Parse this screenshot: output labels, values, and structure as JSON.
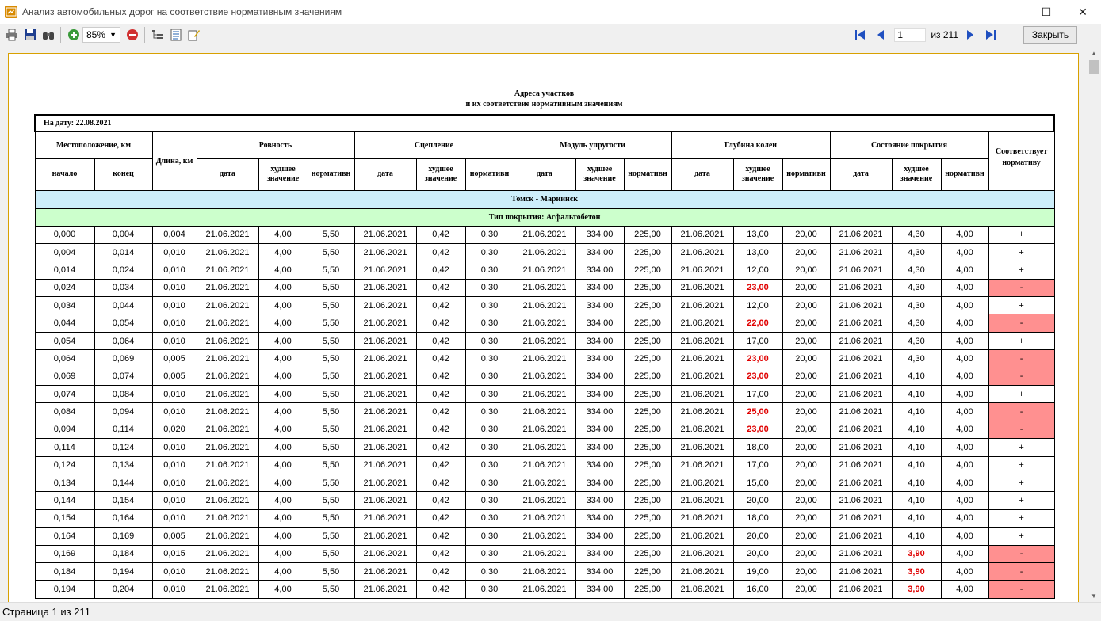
{
  "window": {
    "title": "Анализ автомобильных дорог на соответствие нормативным значениям",
    "minimize_glyph": "—",
    "maximize_glyph": "☐",
    "close_glyph": "✕"
  },
  "toolbar": {
    "zoom_value": "85%",
    "icons": [
      "print-icon",
      "save-icon",
      "find-icon",
      "zoom-in-icon",
      "zoom-out-icon",
      "outline-icon",
      "page-setup-icon",
      "edit-icon"
    ]
  },
  "navigation": {
    "current_page": "1",
    "page_total_label": "из 211",
    "close_label": "Закрыть"
  },
  "report": {
    "title_line1": "Адреса участков",
    "title_line2": "и их соответствие нормативным значениям",
    "date_label": "На дату: 22.08.2021",
    "col_location": "Местоположение, км",
    "col_length": "Длина, км",
    "col_start": "начало",
    "col_end": "конец",
    "groups": [
      "Ровность",
      "Сцепление",
      "Модуль упругости",
      "Глубина колеи",
      "Состояние покрытия"
    ],
    "sub_date": "дата",
    "sub_worst": "худшее значение",
    "sub_norm": "нормативн",
    "col_compliance": "Соответствует нормативу",
    "road": "Томск - Мариинск",
    "cover_type": "Тип покрытия: Асфальтобетон",
    "rows": [
      [
        "0,000",
        "0,004",
        "0,004",
        "21.06.2021",
        "4,00",
        "5,50",
        "21.06.2021",
        "0,42",
        "0,30",
        "21.06.2021",
        "334,00",
        "225,00",
        "21.06.2021",
        "13,00",
        "20,00",
        "21.06.2021",
        "4,30",
        "4,00",
        "+"
      ],
      [
        "0,004",
        "0,014",
        "0,010",
        "21.06.2021",
        "4,00",
        "5,50",
        "21.06.2021",
        "0,42",
        "0,30",
        "21.06.2021",
        "334,00",
        "225,00",
        "21.06.2021",
        "13,00",
        "20,00",
        "21.06.2021",
        "4,30",
        "4,00",
        "+"
      ],
      [
        "0,014",
        "0,024",
        "0,010",
        "21.06.2021",
        "4,00",
        "5,50",
        "21.06.2021",
        "0,42",
        "0,30",
        "21.06.2021",
        "334,00",
        "225,00",
        "21.06.2021",
        "12,00",
        "20,00",
        "21.06.2021",
        "4,30",
        "4,00",
        "+"
      ],
      [
        "0,024",
        "0,034",
        "0,010",
        "21.06.2021",
        "4,00",
        "5,50",
        "21.06.2021",
        "0,42",
        "0,30",
        "21.06.2021",
        "334,00",
        "225,00",
        "21.06.2021",
        "23,00",
        "20,00",
        "21.06.2021",
        "4,30",
        "4,00",
        "-"
      ],
      [
        "0,034",
        "0,044",
        "0,010",
        "21.06.2021",
        "4,00",
        "5,50",
        "21.06.2021",
        "0,42",
        "0,30",
        "21.06.2021",
        "334,00",
        "225,00",
        "21.06.2021",
        "12,00",
        "20,00",
        "21.06.2021",
        "4,30",
        "4,00",
        "+"
      ],
      [
        "0,044",
        "0,054",
        "0,010",
        "21.06.2021",
        "4,00",
        "5,50",
        "21.06.2021",
        "0,42",
        "0,30",
        "21.06.2021",
        "334,00",
        "225,00",
        "21.06.2021",
        "22,00",
        "20,00",
        "21.06.2021",
        "4,30",
        "4,00",
        "-"
      ],
      [
        "0,054",
        "0,064",
        "0,010",
        "21.06.2021",
        "4,00",
        "5,50",
        "21.06.2021",
        "0,42",
        "0,30",
        "21.06.2021",
        "334,00",
        "225,00",
        "21.06.2021",
        "17,00",
        "20,00",
        "21.06.2021",
        "4,30",
        "4,00",
        "+"
      ],
      [
        "0,064",
        "0,069",
        "0,005",
        "21.06.2021",
        "4,00",
        "5,50",
        "21.06.2021",
        "0,42",
        "0,30",
        "21.06.2021",
        "334,00",
        "225,00",
        "21.06.2021",
        "23,00",
        "20,00",
        "21.06.2021",
        "4,30",
        "4,00",
        "-"
      ],
      [
        "0,069",
        "0,074",
        "0,005",
        "21.06.2021",
        "4,00",
        "5,50",
        "21.06.2021",
        "0,42",
        "0,30",
        "21.06.2021",
        "334,00",
        "225,00",
        "21.06.2021",
        "23,00",
        "20,00",
        "21.06.2021",
        "4,10",
        "4,00",
        "-"
      ],
      [
        "0,074",
        "0,084",
        "0,010",
        "21.06.2021",
        "4,00",
        "5,50",
        "21.06.2021",
        "0,42",
        "0,30",
        "21.06.2021",
        "334,00",
        "225,00",
        "21.06.2021",
        "17,00",
        "20,00",
        "21.06.2021",
        "4,10",
        "4,00",
        "+"
      ],
      [
        "0,084",
        "0,094",
        "0,010",
        "21.06.2021",
        "4,00",
        "5,50",
        "21.06.2021",
        "0,42",
        "0,30",
        "21.06.2021",
        "334,00",
        "225,00",
        "21.06.2021",
        "25,00",
        "20,00",
        "21.06.2021",
        "4,10",
        "4,00",
        "-"
      ],
      [
        "0,094",
        "0,114",
        "0,020",
        "21.06.2021",
        "4,00",
        "5,50",
        "21.06.2021",
        "0,42",
        "0,30",
        "21.06.2021",
        "334,00",
        "225,00",
        "21.06.2021",
        "23,00",
        "20,00",
        "21.06.2021",
        "4,10",
        "4,00",
        "-"
      ],
      [
        "0,114",
        "0,124",
        "0,010",
        "21.06.2021",
        "4,00",
        "5,50",
        "21.06.2021",
        "0,42",
        "0,30",
        "21.06.2021",
        "334,00",
        "225,00",
        "21.06.2021",
        "18,00",
        "20,00",
        "21.06.2021",
        "4,10",
        "4,00",
        "+"
      ],
      [
        "0,124",
        "0,134",
        "0,010",
        "21.06.2021",
        "4,00",
        "5,50",
        "21.06.2021",
        "0,42",
        "0,30",
        "21.06.2021",
        "334,00",
        "225,00",
        "21.06.2021",
        "17,00",
        "20,00",
        "21.06.2021",
        "4,10",
        "4,00",
        "+"
      ],
      [
        "0,134",
        "0,144",
        "0,010",
        "21.06.2021",
        "4,00",
        "5,50",
        "21.06.2021",
        "0,42",
        "0,30",
        "21.06.2021",
        "334,00",
        "225,00",
        "21.06.2021",
        "15,00",
        "20,00",
        "21.06.2021",
        "4,10",
        "4,00",
        "+"
      ],
      [
        "0,144",
        "0,154",
        "0,010",
        "21.06.2021",
        "4,00",
        "5,50",
        "21.06.2021",
        "0,42",
        "0,30",
        "21.06.2021",
        "334,00",
        "225,00",
        "21.06.2021",
        "20,00",
        "20,00",
        "21.06.2021",
        "4,10",
        "4,00",
        "+"
      ],
      [
        "0,154",
        "0,164",
        "0,010",
        "21.06.2021",
        "4,00",
        "5,50",
        "21.06.2021",
        "0,42",
        "0,30",
        "21.06.2021",
        "334,00",
        "225,00",
        "21.06.2021",
        "18,00",
        "20,00",
        "21.06.2021",
        "4,10",
        "4,00",
        "+"
      ],
      [
        "0,164",
        "0,169",
        "0,005",
        "21.06.2021",
        "4,00",
        "5,50",
        "21.06.2021",
        "0,42",
        "0,30",
        "21.06.2021",
        "334,00",
        "225,00",
        "21.06.2021",
        "20,00",
        "20,00",
        "21.06.2021",
        "4,10",
        "4,00",
        "+"
      ],
      [
        "0,169",
        "0,184",
        "0,015",
        "21.06.2021",
        "4,00",
        "5,50",
        "21.06.2021",
        "0,42",
        "0,30",
        "21.06.2021",
        "334,00",
        "225,00",
        "21.06.2021",
        "20,00",
        "20,00",
        "21.06.2021",
        "3,90",
        "4,00",
        "-"
      ],
      [
        "0,184",
        "0,194",
        "0,010",
        "21.06.2021",
        "4,00",
        "5,50",
        "21.06.2021",
        "0,42",
        "0,30",
        "21.06.2021",
        "334,00",
        "225,00",
        "21.06.2021",
        "19,00",
        "20,00",
        "21.06.2021",
        "3,90",
        "4,00",
        "-"
      ],
      [
        "0,194",
        "0,204",
        "0,010",
        "21.06.2021",
        "4,00",
        "5,50",
        "21.06.2021",
        "0,42",
        "0,30",
        "21.06.2021",
        "334,00",
        "225,00",
        "21.06.2021",
        "16,00",
        "20,00",
        "21.06.2021",
        "3,90",
        "4,00",
        "-"
      ]
    ],
    "bad_cells": [
      [
        3,
        13
      ],
      [
        5,
        13
      ],
      [
        7,
        13
      ],
      [
        8,
        13
      ],
      [
        10,
        13
      ],
      [
        11,
        13
      ],
      [
        18,
        16
      ],
      [
        19,
        16
      ],
      [
        20,
        16
      ]
    ]
  },
  "status": {
    "page_label": "Страница 1 из 211"
  },
  "colors": {
    "fail_bg": "#ff9090",
    "bad_text": "#e00000",
    "road_bg": "#cdeefa",
    "cover_bg": "#ccffcc",
    "page_border": "#d8a000"
  }
}
